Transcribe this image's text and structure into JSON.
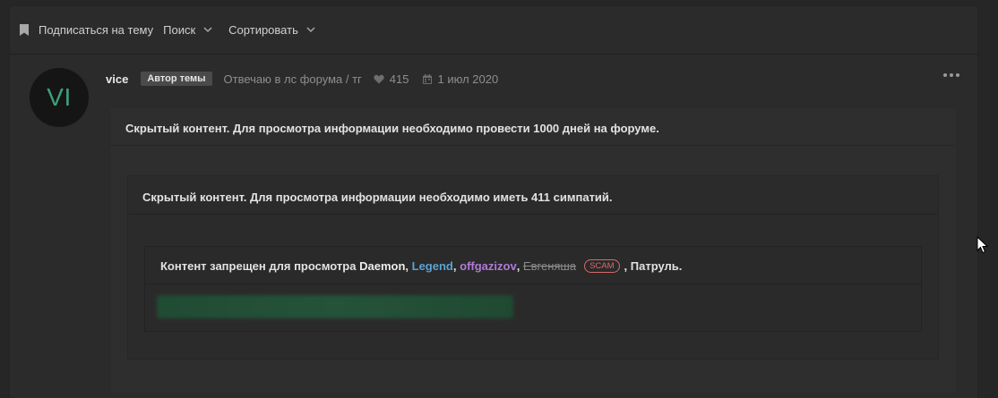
{
  "toolbar": {
    "subscribe_label": "Подписаться на тему",
    "search_label": "Поиск",
    "sort_label": "Сортировать"
  },
  "post": {
    "avatar_initials": "VI",
    "username": "vice",
    "author_badge": "Автор темы",
    "user_status": "Отвечаю в лс форума / тг",
    "likes": "415",
    "date": "1 июл 2020"
  },
  "hidden": {
    "level1_text": "Скрытый контент. Для просмотра информации необходимо провести 1000 дней на форуме.",
    "level2_text": "Скрытый контент. Для просмотра информации необходимо иметь 411 симпатий.",
    "restrict_prefix": "Контент запрещен для просмотра",
    "sep_comma": ",",
    "users": {
      "daemon": "Daemon",
      "legend": "Legend",
      "offgazizov": "offgazizov",
      "evgeniasha": "Евгеняша"
    },
    "scam_badge": "SCAM",
    "restrict_suffix": ", Патруль."
  },
  "colors": {
    "background": "#262626",
    "legend_user": "#5aa2d6",
    "offgazizov_user": "#b07ad6",
    "scam_badge": "#d86a6a",
    "avatar_text": "#3fa07a"
  },
  "icons": [
    "bookmark-icon",
    "chevron-down-icon",
    "heart-icon",
    "calendar-icon",
    "more-options-icon",
    "mouse-pointer-icon"
  ]
}
